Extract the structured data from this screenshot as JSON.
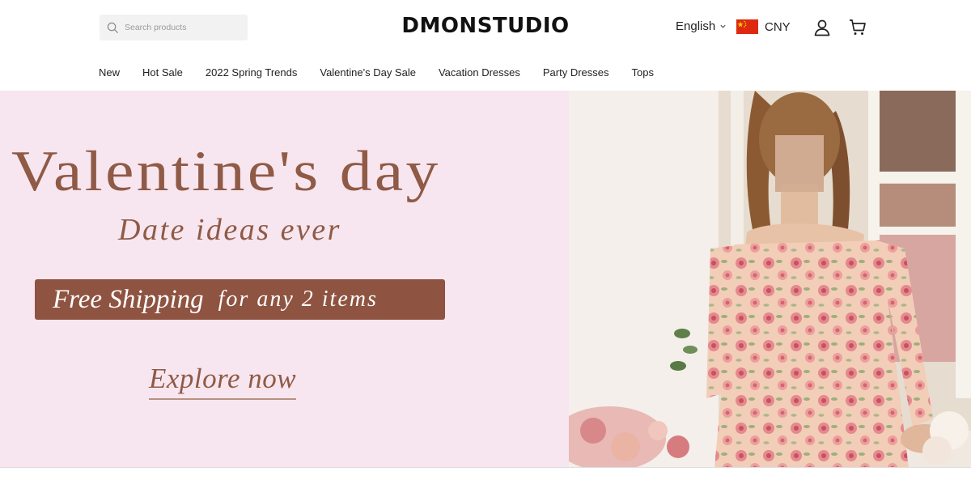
{
  "search": {
    "placeholder": "Search products"
  },
  "brand": {
    "logo": "DMONSTUDIO"
  },
  "header": {
    "language": "English",
    "currency": "CNY"
  },
  "nav": {
    "items": [
      {
        "label": "New"
      },
      {
        "label": "Hot Sale"
      },
      {
        "label": "2022 Spring Trends"
      },
      {
        "label": "Valentine's Day Sale"
      },
      {
        "label": "Vacation Dresses"
      },
      {
        "label": "Party Dresses"
      },
      {
        "label": "Tops"
      }
    ]
  },
  "banner": {
    "headline": "Valentine's day",
    "subline": "Date ideas ever",
    "shipping_main": "Free Shipping",
    "shipping_rest": "for any 2 items",
    "cta": "Explore now"
  },
  "colors": {
    "banner_bg": "#f7e6ef",
    "accent_brown": "#8f5a46",
    "ship_box": "#8e5341"
  },
  "icons": [
    "search-icon",
    "chevron-down-icon",
    "china-flag-icon",
    "user-icon",
    "cart-icon"
  ]
}
